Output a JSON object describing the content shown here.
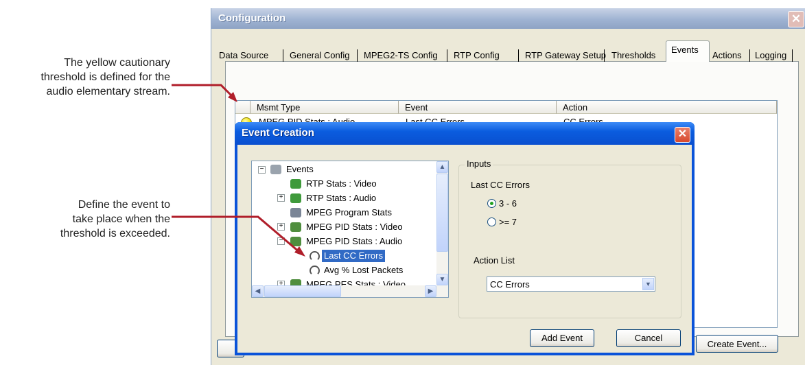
{
  "annotations": {
    "threshold_note": [
      "The yellow cautionary",
      "threshold is defined for the",
      "audio elementary stream."
    ],
    "event_note": [
      "Define the event to",
      "take place when the",
      "threshold is exceeded."
    ]
  },
  "config_window": {
    "title": "Configuration",
    "close_glyph": "✕",
    "tabs": [
      "Data Source",
      "General Config",
      "MPEG2-TS Config",
      "RTP Config",
      "RTP Gateway Setup",
      "Thresholds",
      "Events",
      "Actions",
      "Logging"
    ],
    "active_tab": "Events",
    "columns": [
      "Msmt Type",
      "Event",
      "Action"
    ],
    "rows": [
      {
        "status": "yellow",
        "msmt_type": "MPEG PID Stats : Audio",
        "event": "Last CC Errors",
        "action": "CC Errors"
      }
    ],
    "create_event_label": "Create Event..."
  },
  "event_dialog": {
    "title": "Event Creation",
    "close_glyph": "✕",
    "tree": [
      {
        "label": "Events",
        "icon": "events-folder-icon",
        "expander": "−"
      },
      {
        "label": "RTP Stats : Video",
        "icon": "rtp-stats-icon"
      },
      {
        "label": "RTP Stats : Audio",
        "icon": "rtp-stats-icon",
        "expander": "+"
      },
      {
        "label": "MPEG Program Stats",
        "icon": "program-stats-icon"
      },
      {
        "label": "MPEG PID Stats : Video",
        "icon": "pid-stats-icon",
        "expander": "+"
      },
      {
        "label": "MPEG PID Stats : Audio",
        "icon": "pid-stats-icon",
        "expander": "−"
      },
      {
        "label": "Last CC Errors",
        "icon": "event-ring-icon",
        "selected": true
      },
      {
        "label": "Avg % Lost Packets",
        "icon": "event-ring-icon"
      },
      {
        "label": "MPEG PES Stats : Video",
        "icon": "pes-stats-icon",
        "expander": "+"
      }
    ],
    "inputs": {
      "legend": "Inputs",
      "heading": "Last CC Errors",
      "options": [
        {
          "label": "3 - 6",
          "selected": true
        },
        {
          "label": ">= 7",
          "selected": false
        }
      ],
      "action_list_label": "Action List",
      "action_list_value": "CC Errors"
    },
    "add_event_label": "Add Event",
    "cancel_label": "Cancel"
  },
  "colors": {
    "arrow": "#b01e2a",
    "xp_blue": "#0a53d9",
    "selection": "#316ac5",
    "status_yellow": "#f0e000"
  }
}
